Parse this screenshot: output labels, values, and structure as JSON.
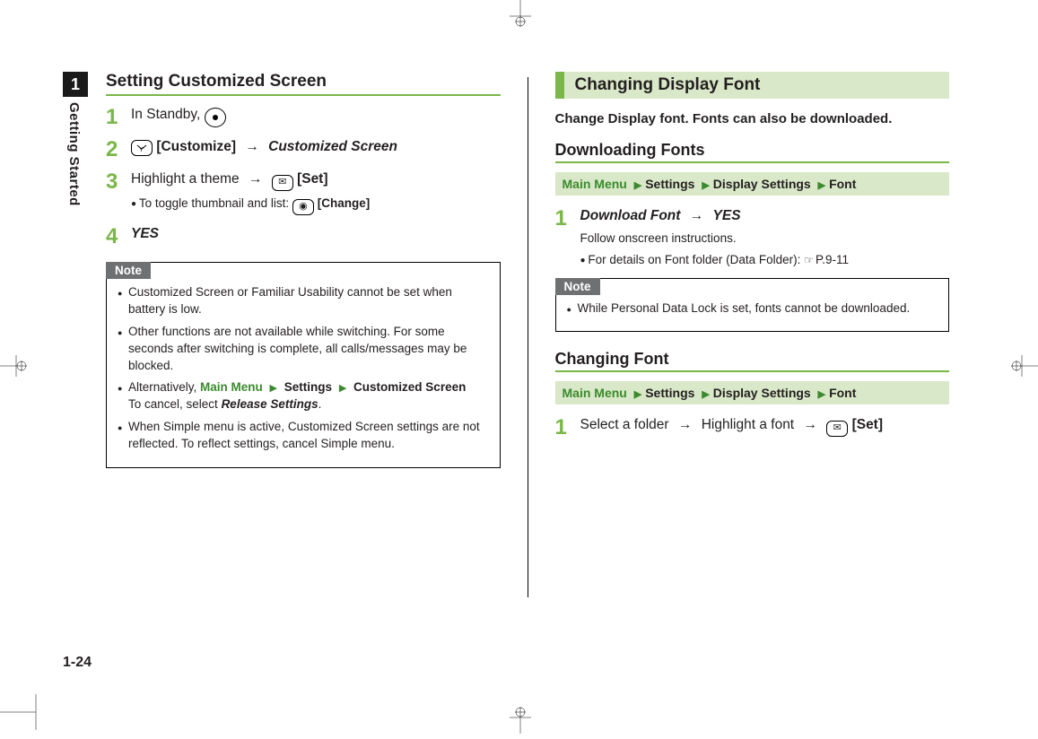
{
  "side_tab": {
    "num": "1",
    "label": "Getting Started"
  },
  "page_number": "1-24",
  "left": {
    "h1": "Setting Customized Screen",
    "steps": [
      {
        "num": "1",
        "main_pre": "In Standby, "
      },
      {
        "num": "2",
        "customize": "[Customize]",
        "arrow": "→",
        "screen": "Customized Screen"
      },
      {
        "num": "3",
        "main_pre": "Highlight a theme ",
        "arrow": "→",
        "set": "[Set]",
        "sub_pre": "To toggle thumbnail and list: ",
        "change": "[Change]"
      },
      {
        "num": "4",
        "yes": "YES"
      }
    ],
    "note": {
      "title": "Note",
      "items": [
        {
          "text": "Customized Screen or Familiar Usability cannot be set when battery is low."
        },
        {
          "text": "Other functions are not available while switching. For some seconds after switching is complete, all calls/messages may be blocked."
        },
        {
          "alt_pre": "Alternatively, ",
          "mm": "Main Menu",
          "s1": "Settings",
          "s2": "Customized Screen",
          "cancel_pre": "To cancel, select ",
          "release": "Release Settings",
          "period": "."
        },
        {
          "text": "When Simple menu is active, Customized Screen settings are not reflected. To reflect settings, cancel Simple menu."
        }
      ]
    }
  },
  "right": {
    "h2": "Changing Display Font",
    "intro": "Change Display font. Fonts can also be downloaded.",
    "section1": {
      "subhead": "Downloading Fonts",
      "menu": {
        "mm": "Main Menu",
        "a": "Settings",
        "b": "Display Settings",
        "c": "Font"
      },
      "step": {
        "num": "1",
        "dl": "Download Font",
        "arrow": "→",
        "yes": "YES",
        "sub1": "Follow onscreen instructions.",
        "sub2_pre": "For details on Font folder (Data Folder): ",
        "ref": "P.9-11"
      },
      "note": {
        "title": "Note",
        "item": "While Personal Data Lock is set, fonts cannot be downloaded."
      }
    },
    "section2": {
      "subhead": "Changing Font",
      "menu": {
        "mm": "Main Menu",
        "a": "Settings",
        "b": "Display Settings",
        "c": "Font"
      },
      "step": {
        "num": "1",
        "pre": "Select a folder ",
        "arrow1": "→",
        "mid": " Highlight a font ",
        "arrow2": "→",
        "set": "[Set]"
      }
    }
  }
}
